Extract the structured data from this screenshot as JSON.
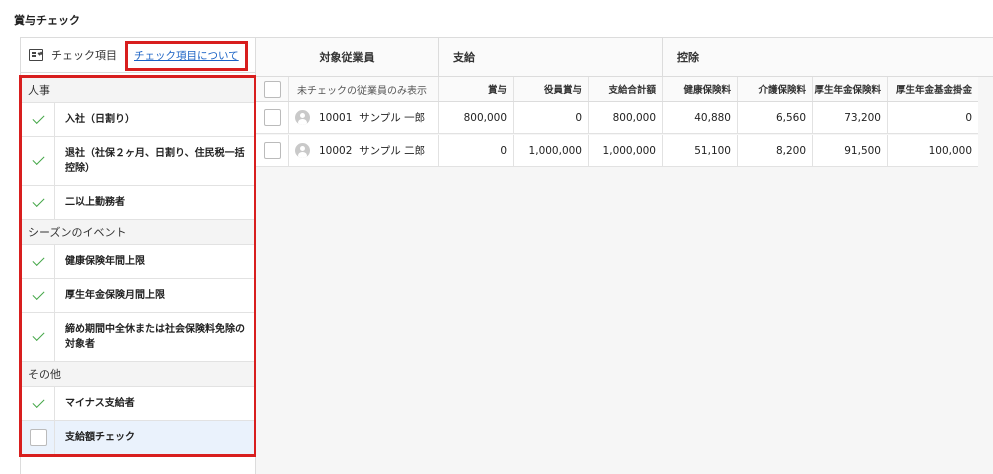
{
  "page": {
    "title": "賞与チェック"
  },
  "left_panel": {
    "header_label": "チェック項目",
    "about_link": "チェック項目について",
    "categories": [
      {
        "name": "人事",
        "items": [
          {
            "label": "入社（日割り）",
            "checked": true
          },
          {
            "label": "退社（社保２ヶ月、日割り、住民税一括控除）",
            "checked": true
          },
          {
            "label": "二以上勤務者",
            "checked": true
          }
        ]
      },
      {
        "name": "シーズンのイベント",
        "items": [
          {
            "label": "健康保険年間上限",
            "checked": true
          },
          {
            "label": "厚生年金保険月間上限",
            "checked": true
          },
          {
            "label": "締め期間中全休または社会保険料免除の対象者",
            "checked": true
          }
        ]
      },
      {
        "name": "その他",
        "items": [
          {
            "label": "マイナス支給者",
            "checked": true
          },
          {
            "label": "支給額チェック",
            "checked": false
          }
        ]
      }
    ]
  },
  "table": {
    "group_headers": {
      "employee": "対象従業員",
      "pay": "支給",
      "deduction": "控除"
    },
    "filter_label": "未チェックの従業員のみ表示",
    "columns": [
      "賞与",
      "役員賞与",
      "支給合計額",
      "健康保険料",
      "介護保険料",
      "厚生年金保険料",
      "厚生年金基金掛金"
    ],
    "rows": [
      {
        "id": "10001",
        "name": "サンプル 一郎",
        "values": [
          "800,000",
          "0",
          "800,000",
          "40,880",
          "6,560",
          "73,200",
          "0"
        ]
      },
      {
        "id": "10002",
        "name": "サンプル 二郎",
        "values": [
          "0",
          "1,000,000",
          "1,000,000",
          "51,100",
          "8,200",
          "91,500",
          "100,000"
        ]
      }
    ]
  },
  "colors": {
    "check": "#45a749",
    "highlight": "#d81e1e",
    "link": "#1a62c5",
    "active_row": "#eaf2fc"
  }
}
